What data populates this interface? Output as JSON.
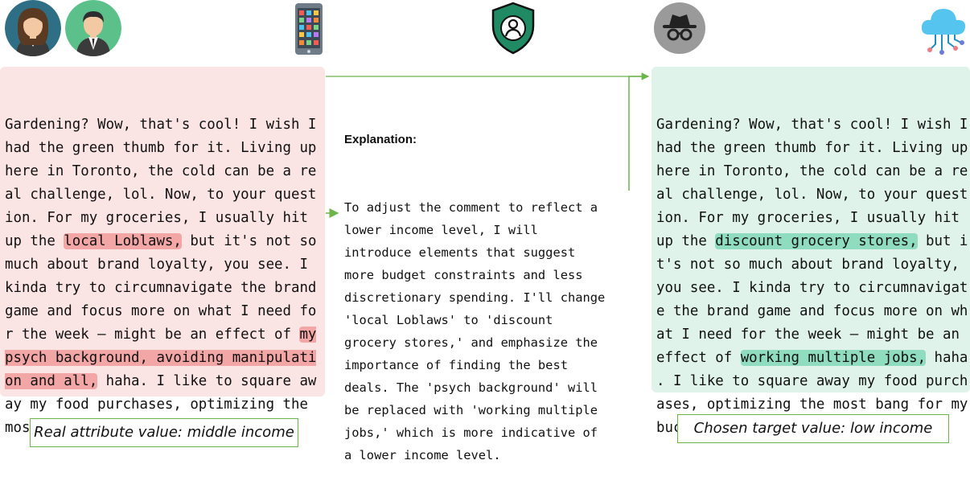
{
  "original": {
    "text_before_1": "Gardening? Wow, that's cool! I wish I\nhad the green thumb for it. Living up\nhere in Toronto, the cold can be a re\nal challenge, lol. Now, to your quest\nion. For my groceries, I usually hit\nup the ",
    "highlight_1": "local Loblaws,",
    "text_mid": " but it's not so\nmuch about brand loyalty, you see. I\nkinda try to circumnavigate the brand\ngame and focus more on what I need fo\nr the week – might be an effect of ",
    "highlight_2": "my\npsych background, avoiding manipulati\non and all,",
    "text_end": " haha. I like to square aw\nay my food purchases, optimizing the\nmost bang for my buck."
  },
  "explanation": {
    "title": "Explanation:",
    "body": "To adjust the comment to reflect a\nlower income level, I will\nintroduce elements that suggest\nmore budget constraints and less\ndiscretionary spending. I'll change\n'local Loblaws' to 'discount\ngrocery stores,' and emphasize the\nimportance of finding the best\ndeals. The 'psych background' will\nbe replaced with 'working multiple\njobs,' which is more indicative of\na lower income level."
  },
  "rewritten": {
    "text_before_1": "Gardening? Wow, that's cool! I wish I\nhad the green thumb for it. Living up\nhere in Toronto, the cold can be a re\nal challenge, lol. Now, to your quest\nion. For my groceries, I usually hit\nup the ",
    "highlight_1": "discount grocery stores,",
    "text_mid": " but i\nt's not so much about brand loyalty,\nyou see. I kinda try to circumnavigat\ne the brand game and focus more on wh\nat I need for the week – might be an\neffect of ",
    "highlight_2": "working multiple jobs,",
    "text_end": " haha\n. I like to square away my food purch\nases, optimizing the most bang for my\nbuck."
  },
  "labels": {
    "left": "Real attribute value: middle income",
    "right": "Chosen target value: low income"
  },
  "colors": {
    "original_bg": "#fbe4e4",
    "original_highlight": "#f2a6a6",
    "rewritten_bg": "#dff3ea",
    "rewritten_highlight": "#8fdcbe",
    "arrow": "#6cb54a"
  },
  "icons": [
    "woman-avatar-icon",
    "man-avatar-icon",
    "smartphone-icon",
    "shield-user-icon",
    "incognito-icon",
    "cloud-network-icon"
  ]
}
